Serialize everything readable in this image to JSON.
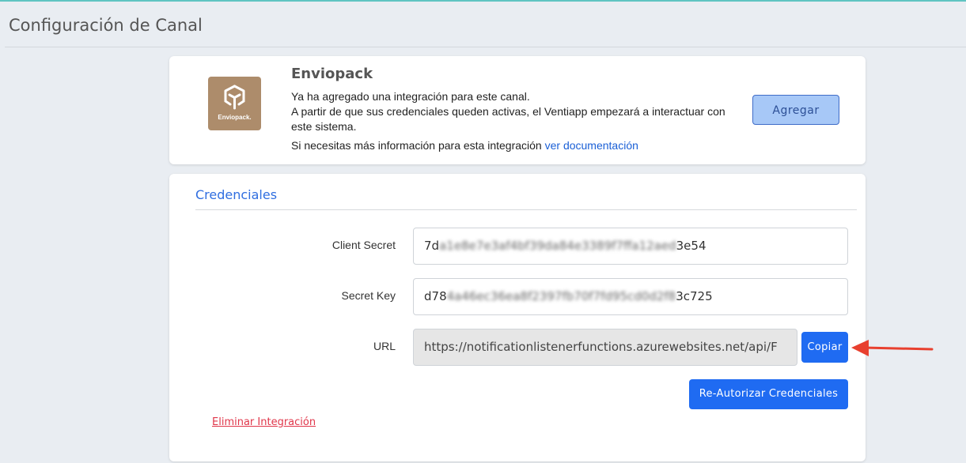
{
  "header": {
    "title": "Configuración de Canal"
  },
  "integration": {
    "logo_text": "Enviopack.",
    "name": "Enviopack",
    "line1": "Ya ha agregado una integración para este canal.",
    "line2": "A partir de que sus credenciales queden activas, el Ventiapp empezará a interactuar con este sistema.",
    "more_prefix": "Si necesitas más información para esta integración",
    "doc_link": "ver documentación",
    "add_button": "Agregar"
  },
  "credentials": {
    "heading": "Credenciales",
    "client_secret": {
      "label": "Client Secret",
      "value_start": "7d",
      "value_hidden": "a1e8e7e3af4bf39da84e3389f7ffa12aed",
      "value_end": "3e54"
    },
    "secret_key": {
      "label": "Secret Key",
      "value_start": "d78",
      "value_hidden": "4a46ec36ea8f2397fb70f7fd95cd0d2f8",
      "value_end": "3c725"
    },
    "url": {
      "label": "URL",
      "value": "https://notificationlistenerfunctions.azurewebsites.net/api/F"
    },
    "copy_button": "Copiar",
    "reauth_button": "Re-Autorizar Credenciales",
    "delete_link": "Eliminar Integración"
  },
  "colors": {
    "primary": "#1f6bf2",
    "danger": "#e0364a",
    "logo_bg": "#ad8c6b",
    "annotation_arrow": "#e8402f"
  },
  "icons": {
    "logo": "enviopack-box-icon",
    "annotation": "red-arrow-icon"
  }
}
